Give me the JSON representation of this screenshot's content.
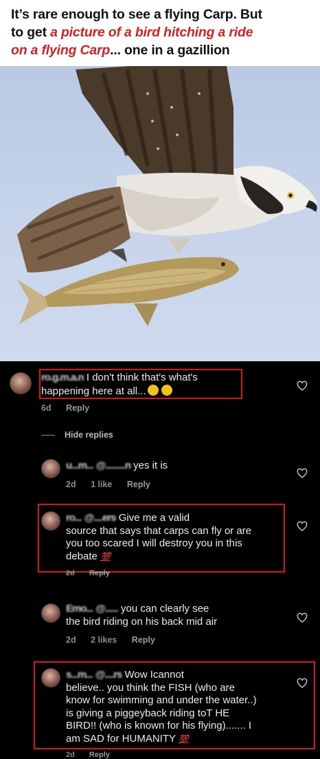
{
  "header": {
    "line1": "It’s rare enough to see a flying Carp. But",
    "line2_plain": "to get ",
    "line2_red": "a picture of a bird hitching a ride",
    "line3_red": "on a flying Carp",
    "line3_plain": "... one in a gazillion"
  },
  "comments": [
    {
      "username": "ro.g.m.a.n",
      "text": "I don't think that's what's",
      "text2": "happening here at all...",
      "time": "6d",
      "reply": "Reply"
    },
    {
      "hide_replies": "Hide replies"
    },
    {
      "username": "u...m...",
      "mention": "@.........n",
      "text": "yes it is",
      "time": "2d",
      "likes": "1 like",
      "reply": "Reply"
    },
    {
      "username": "ro...",
      "mention": "@....ers",
      "text": "Give me a valid",
      "text2": "source that says that carps can fly or are",
      "text3": "you too scared I will destroy you in this",
      "text4": "debate",
      "hundred": "💯",
      "time": "2d",
      "reply": "Reply"
    },
    {
      "username": "Emo...",
      "mention": "@......",
      "text": "you can clearly see",
      "text2": "the bird riding on his back mid air",
      "time": "2d",
      "likes": "2 likes",
      "reply": "Reply"
    },
    {
      "username": "s...m...",
      "mention": "@....rs",
      "text": "Wow  Icannot",
      "text2": "believe.. you think the FISH (who are",
      "text3": "know for swimming and under the water..)",
      "text4": "is giving a piggeyback riding toT HE",
      "text5": "BIRD!! (who is known for his flying)....... I",
      "text6": "am SAD for HUMANITY",
      "hundred": "💯",
      "time": "2d",
      "reply": "Reply"
    }
  ],
  "colors": {
    "accent_red": "#d42020",
    "box_red": "#d8141a",
    "background": "#000000"
  },
  "icons": [
    "heart-icon",
    "avatar",
    "emoji-icon",
    "hundred-points-icon"
  ]
}
